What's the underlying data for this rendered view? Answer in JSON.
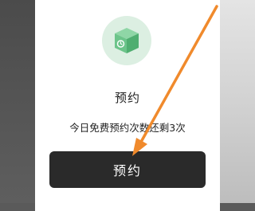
{
  "dialog": {
    "icon": "green-cube-clock-icon",
    "title": "预约",
    "message": "今日免费预约次数还剩3次",
    "button_label": "预约"
  },
  "annotation": {
    "icon": "orange-arrow-icon",
    "color": "#f08a2c"
  },
  "colors": {
    "icon_green": "#6cc48a",
    "icon_bg": "#dcefe2",
    "button_bg": "#2a2a2a",
    "button_text": "#ffffff"
  }
}
